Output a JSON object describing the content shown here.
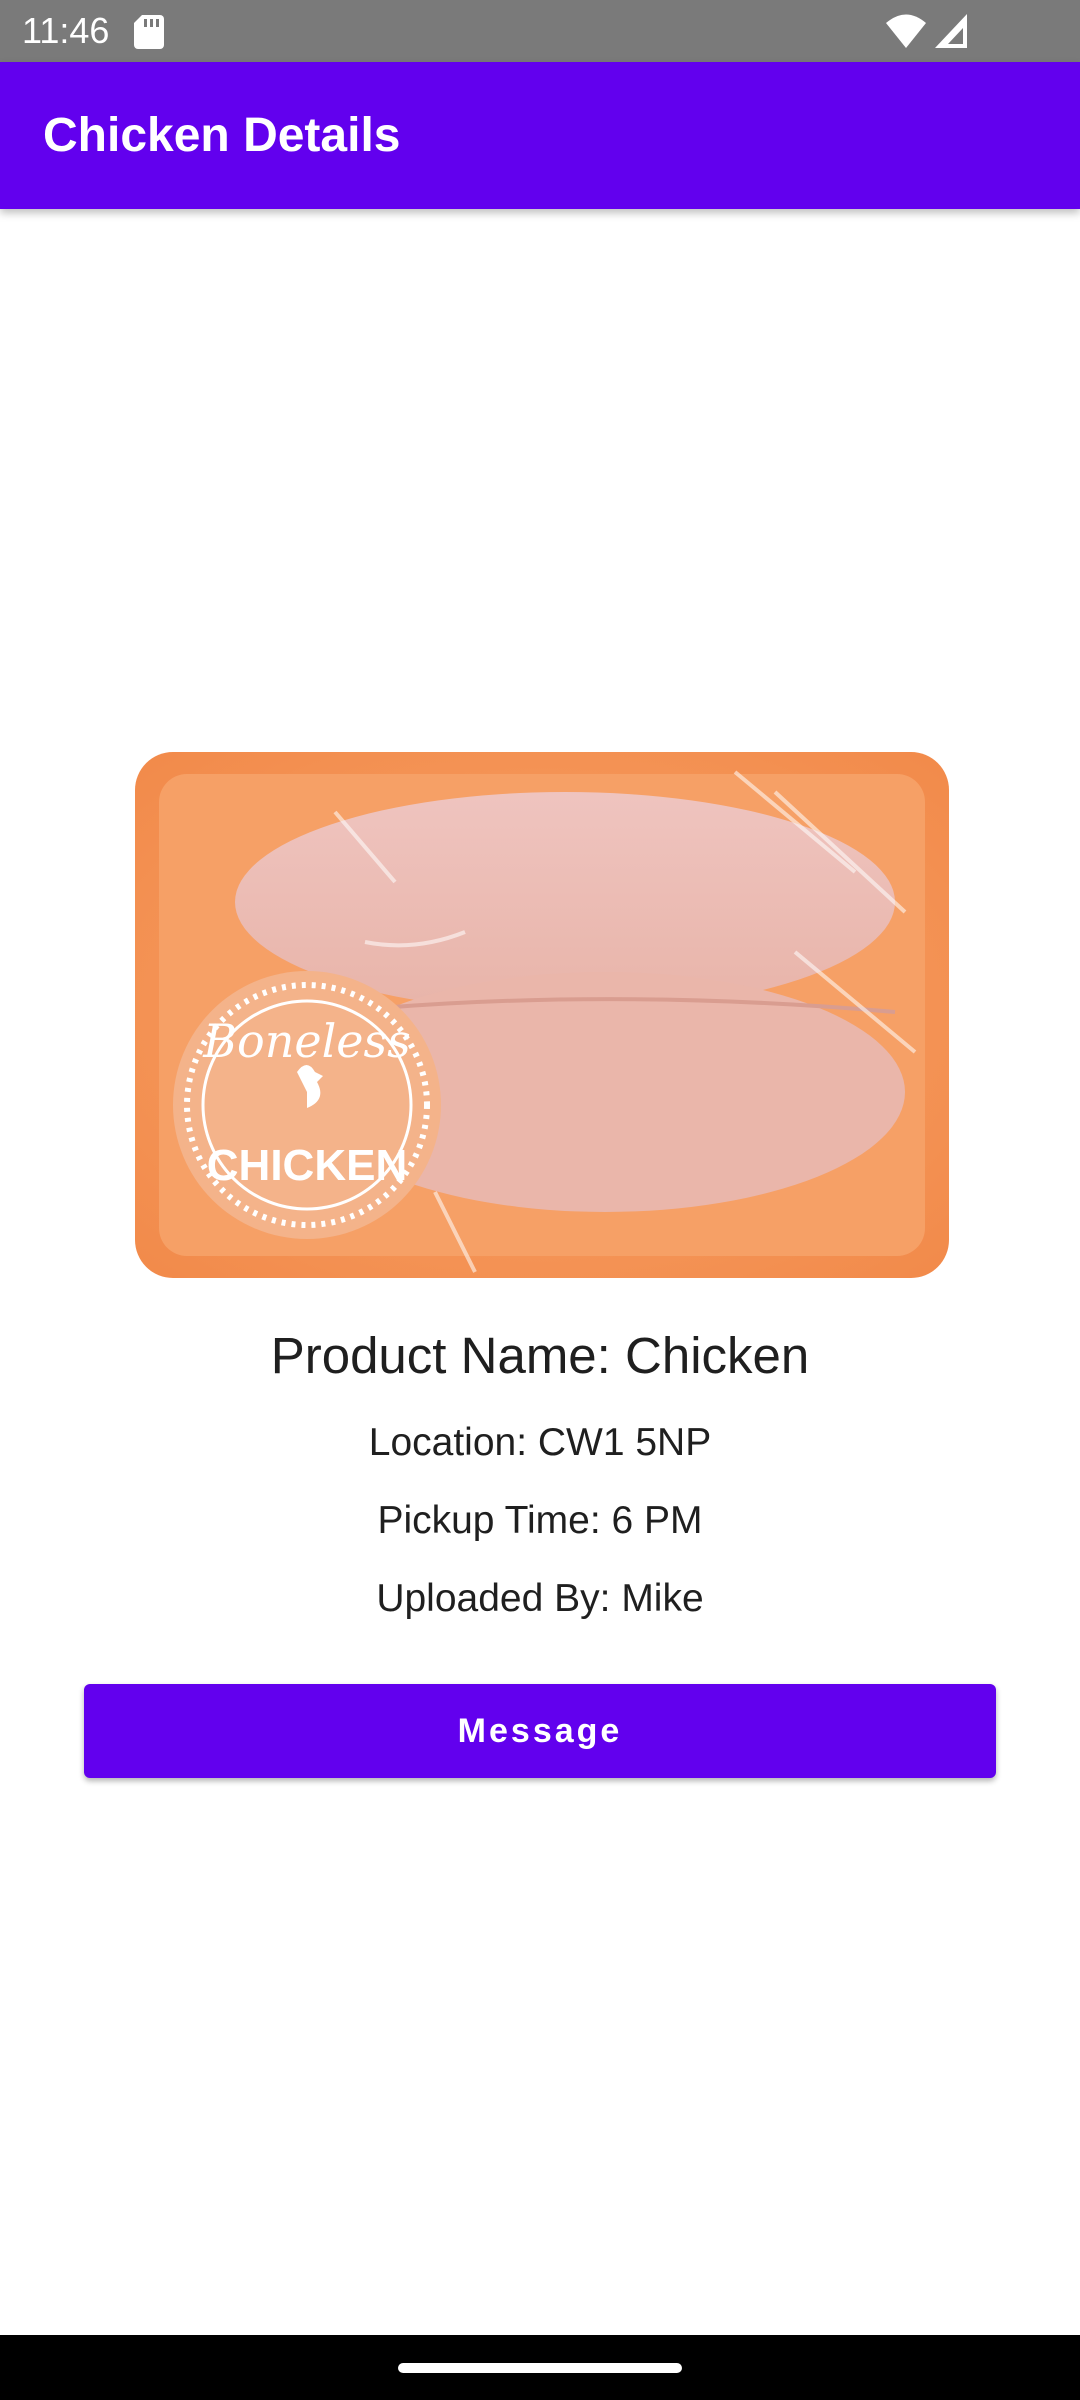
{
  "status_bar": {
    "time": "11:46",
    "icons": [
      "sd-card-icon",
      "wifi-icon",
      "signal-icon"
    ]
  },
  "app_bar": {
    "title": "Chicken Details",
    "color": "#6200ee"
  },
  "product": {
    "image_icon": "packaged-chicken-image",
    "name_line": "Product Name: Chicken",
    "location_line": "Location: CW1 5NP",
    "pickup_line": "Pickup Time: 6 PM",
    "uploader_line": "Uploaded By: Mike",
    "label_top": "Boneless",
    "label_bottom": "CHICKEN"
  },
  "actions": {
    "message_label": "Message"
  }
}
